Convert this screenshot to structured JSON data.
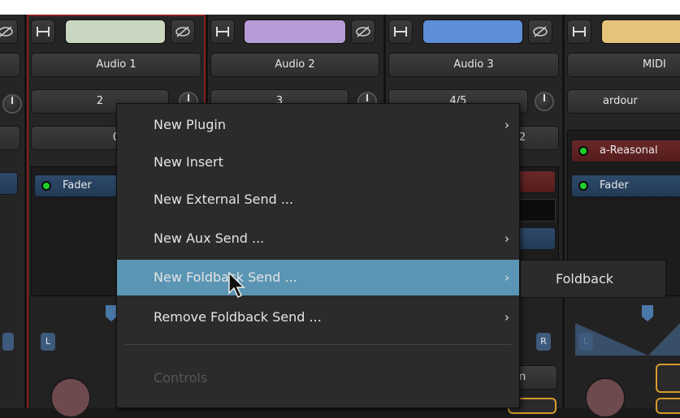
{
  "strips": [
    {
      "name": "",
      "io": "",
      "color": "#3a3a3a"
    },
    {
      "name": "Audio 1",
      "io": "2",
      "color": "#c9d6c0",
      "io2": "0",
      "plugins": [
        {
          "label": "Fader",
          "style": "blue"
        }
      ]
    },
    {
      "name": "Audio 2",
      "io": "3",
      "color": "#b59cd6"
    },
    {
      "name": "Audio 3",
      "io": "4/5",
      "color": "#5d8ed6",
      "io2": "2"
    },
    {
      "name": "MIDI",
      "io": "ardour",
      "color": "#e6c37a",
      "plugins": [
        {
          "label": "a-Reasonal",
          "style": "red"
        },
        {
          "label": "Fader",
          "style": "blue"
        }
      ]
    }
  ],
  "pan_labels": {
    "left": "L",
    "right": "R"
  },
  "partial_right_text": "n",
  "context_menu": {
    "items": [
      {
        "label": "New Plugin",
        "submenu": true
      },
      {
        "label": "New Insert",
        "submenu": false
      },
      {
        "label": "New External Send ...",
        "submenu": false
      },
      {
        "label": "New Aux Send ...",
        "submenu": true
      },
      {
        "label": "New Foldback Send ...",
        "submenu": true,
        "highlighted": true
      },
      {
        "label": "Remove Foldback Send ...",
        "submenu": true
      }
    ],
    "disabled_item": "Controls",
    "arrow": "›"
  },
  "submenu": {
    "items": [
      "Foldback"
    ]
  },
  "colors": {
    "menu_highlight": "#5b95b4",
    "selected_border": "#8a1f1f",
    "led": "#1fcf2a"
  }
}
